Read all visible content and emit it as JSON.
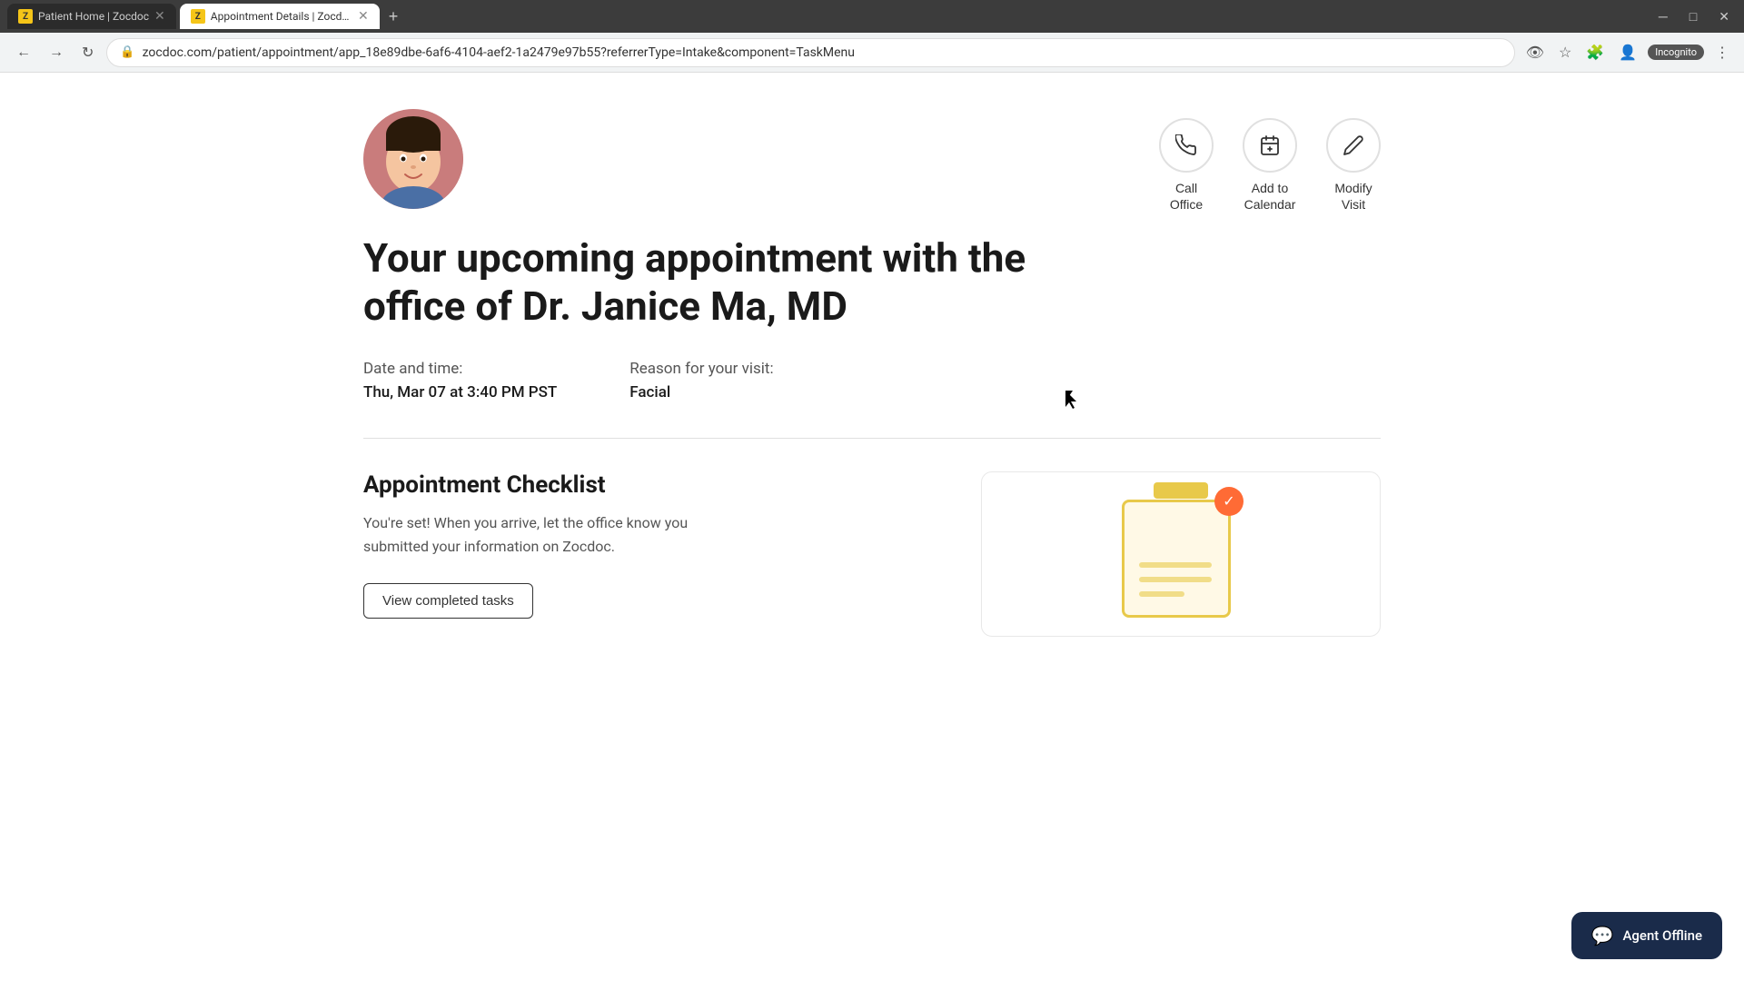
{
  "browser": {
    "tabs": [
      {
        "id": "tab1",
        "favicon": "Z",
        "title": "Patient Home | Zocdoc",
        "active": false
      },
      {
        "id": "tab2",
        "favicon": "Z",
        "title": "Appointment Details | Zocdoc",
        "active": true
      }
    ],
    "url": "zocdoc.com/patient/appointment/app_18e89dbe-6af6-4104-aef2-1a2479e97b55?referrerType=Intake&component=TaskMenu",
    "incognito_label": "Incognito"
  },
  "header": {
    "actions": [
      {
        "id": "call-office",
        "icon": "📞",
        "label": "Call\nOffice"
      },
      {
        "id": "add-calendar",
        "icon": "📅",
        "label": "Add to\nCalendar"
      },
      {
        "id": "modify-visit",
        "icon": "✏️",
        "label": "Modify\nVisit"
      }
    ]
  },
  "appointment": {
    "title": "Your upcoming appointment with the office of Dr. Janice Ma, MD",
    "date_label": "Date and time:",
    "date_value": "Thu, Mar 07 at 3:40 PM PST",
    "reason_label": "Reason for your visit:",
    "reason_value": "Facial"
  },
  "checklist": {
    "title": "Appointment Checklist",
    "description": "You're set! When you arrive, let the office know you submitted your information on Zocdoc.",
    "button_label": "View completed tasks"
  },
  "chat_widget": {
    "label": "Agent Offline"
  }
}
